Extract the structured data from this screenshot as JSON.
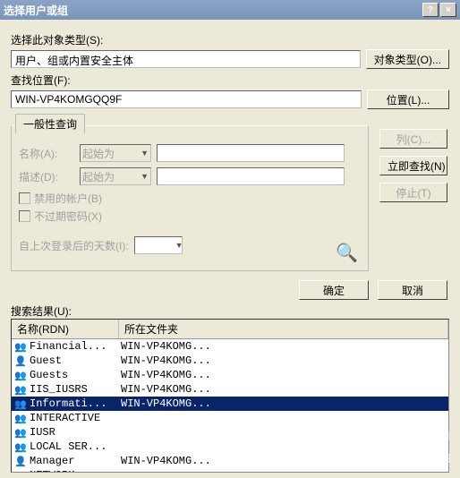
{
  "titlebar": {
    "title": "选择用户或组",
    "help": "?",
    "close": "×"
  },
  "labels": {
    "object_type": "选择此对象类型(S):",
    "location": "查找位置(F):",
    "common_query": "一般性查询",
    "name": "名称(A):",
    "desc": "描述(D):",
    "disabled_acct": "禁用的帐户(B)",
    "nonexp_pwd": "不过期密码(X)",
    "days_since": "自上次登录后的天数(I):",
    "results": "搜索结果(U):",
    "col_name": "名称(RDN)",
    "col_folder": "所在文件夹"
  },
  "fields": {
    "object_type_value": "用户、组或内置安全主体",
    "location_value": "WIN-VP4KOMGQQ9F",
    "starts_with": "起始为"
  },
  "buttons": {
    "object_types": "对象类型(O)...",
    "locations": "位置(L)...",
    "columns": "列(C)...",
    "search_now": "立即查找(N)",
    "stop": "停止(T)",
    "ok": "确定",
    "cancel": "取消"
  },
  "results_list": [
    {
      "icon": "grp",
      "name": "Financial...",
      "folder": "WIN-VP4KOMG..."
    },
    {
      "icon": "user",
      "name": "Guest",
      "folder": "WIN-VP4KOMG..."
    },
    {
      "icon": "grp",
      "name": "Guests",
      "folder": "WIN-VP4KOMG..."
    },
    {
      "icon": "grp",
      "name": "IIS_IUSRS",
      "folder": "WIN-VP4KOMG..."
    },
    {
      "icon": "grp",
      "name": "Informati...",
      "folder": "WIN-VP4KOMG...",
      "selected": true
    },
    {
      "icon": "grp",
      "name": "INTERACTIVE",
      "folder": ""
    },
    {
      "icon": "grp",
      "name": "IUSR",
      "folder": ""
    },
    {
      "icon": "grp",
      "name": "LOCAL SER...",
      "folder": ""
    },
    {
      "icon": "user",
      "name": "Manager",
      "folder": "WIN-VP4KOMG..."
    },
    {
      "icon": "grp",
      "name": "NETWORK",
      "folder": ""
    }
  ],
  "watermark": {
    "big": "51CTO.com",
    "small": "技术博客  Blog"
  }
}
